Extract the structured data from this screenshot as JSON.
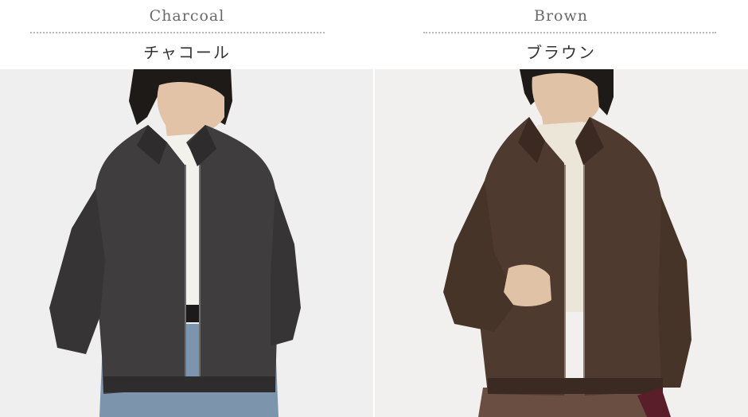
{
  "variants": [
    {
      "name_en": "Charcoal",
      "name_jp": "チャコール",
      "photo_alt": "charcoal-jacket-photo",
      "colors": {
        "jacket": "#3f3d3e",
        "jacket_shadow": "#2e2c2d",
        "inner": "#f3f1ec",
        "pants": "#7d94ad",
        "background": "#efefef"
      }
    },
    {
      "name_en": "Brown",
      "name_jp": "ブラウン",
      "photo_alt": "brown-jacket-photo",
      "colors": {
        "jacket": "#4f3a30",
        "jacket_shadow": "#3a2a22",
        "inner": "#ece6d8",
        "pants": "#6a4e42",
        "background": "#f1f0ee"
      }
    }
  ]
}
